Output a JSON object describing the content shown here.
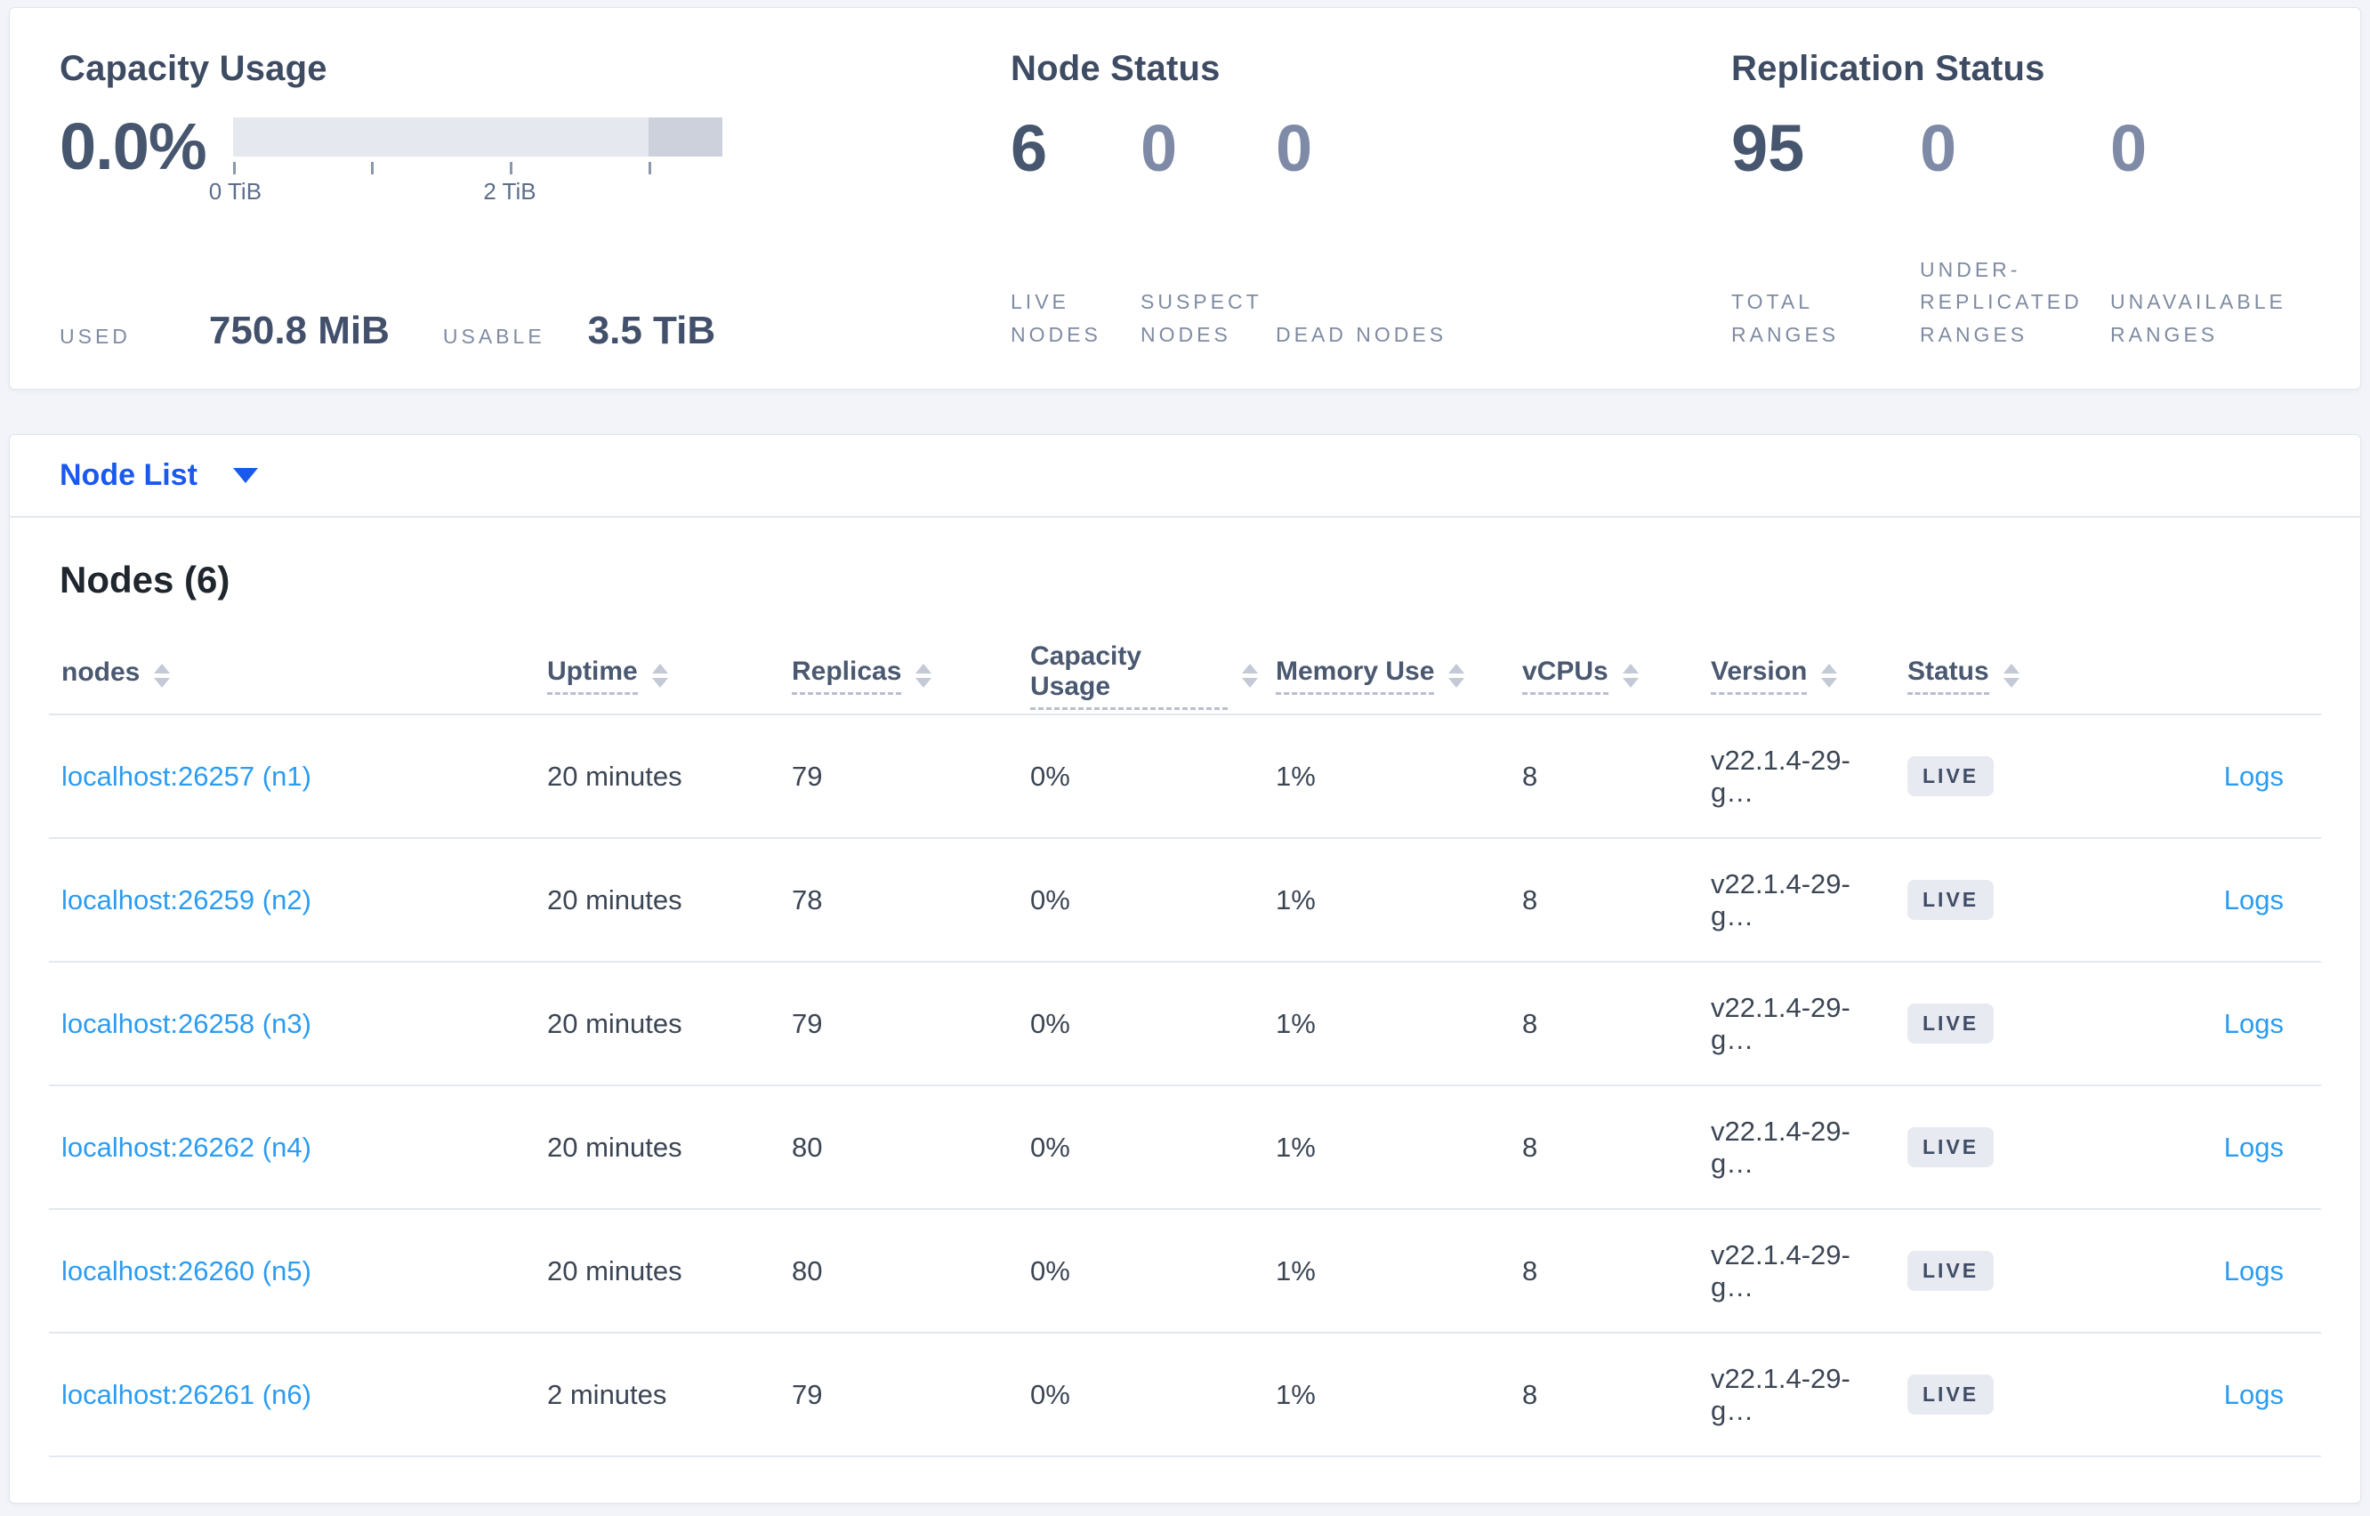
{
  "colors": {
    "page_bg": "#f2f4f9",
    "card_bg": "#ffffff",
    "dropdown_blue": "#1959ee",
    "link_blue": "#2b9cf2",
    "stat_dark": "#47566f",
    "stat_muted": "#7e8aa6",
    "gauge_light": "#e6e8ef",
    "gauge_dark": "#ccd1dc",
    "badge_bg": "#e7eaf0"
  },
  "capacity_panel": {
    "title": "Capacity Usage",
    "percent": "0.0%",
    "axis_tick_labels": [
      "0 TiB",
      "2 TiB"
    ],
    "used_label": "USED",
    "used_value": "750.8 MiB",
    "usable_label": "USABLE",
    "usable_value": "3.5 TiB"
  },
  "node_status_panel": {
    "title": "Node Status",
    "stats": [
      {
        "value": "6",
        "label": "LIVE NODES"
      },
      {
        "value": "0",
        "label": "SUSPECT NODES"
      },
      {
        "value": "0",
        "label": "DEAD NODES"
      }
    ]
  },
  "replication_panel": {
    "title": "Replication Status",
    "stats": [
      {
        "value": "95",
        "label": "TOTAL RANGES"
      },
      {
        "value": "0",
        "label": "UNDER-REPLICATED RANGES"
      },
      {
        "value": "0",
        "label": "UNAVAILABLE RANGES"
      }
    ]
  },
  "node_list_dropdown": {
    "label": "Node List"
  },
  "nodes_table": {
    "title": "Nodes (6)",
    "columns": [
      {
        "label": "nodes"
      },
      {
        "label": "Uptime"
      },
      {
        "label": "Replicas"
      },
      {
        "label": "Capacity Usage"
      },
      {
        "label": "Memory Use"
      },
      {
        "label": "vCPUs"
      },
      {
        "label": "Version"
      },
      {
        "label": "Status"
      },
      {
        "label": ""
      }
    ],
    "rows": [
      {
        "node": "localhost:26257 (n1)",
        "uptime": "20 minutes",
        "replicas": "79",
        "capacity": "0%",
        "memory": "1%",
        "vcpus": "8",
        "version": "v22.1.4-29-g…",
        "status": "LIVE",
        "logs": "Logs"
      },
      {
        "node": "localhost:26259 (n2)",
        "uptime": "20 minutes",
        "replicas": "78",
        "capacity": "0%",
        "memory": "1%",
        "vcpus": "8",
        "version": "v22.1.4-29-g…",
        "status": "LIVE",
        "logs": "Logs"
      },
      {
        "node": "localhost:26258 (n3)",
        "uptime": "20 minutes",
        "replicas": "79",
        "capacity": "0%",
        "memory": "1%",
        "vcpus": "8",
        "version": "v22.1.4-29-g…",
        "status": "LIVE",
        "logs": "Logs"
      },
      {
        "node": "localhost:26262 (n4)",
        "uptime": "20 minutes",
        "replicas": "80",
        "capacity": "0%",
        "memory": "1%",
        "vcpus": "8",
        "version": "v22.1.4-29-g…",
        "status": "LIVE",
        "logs": "Logs"
      },
      {
        "node": "localhost:26260 (n5)",
        "uptime": "20 minutes",
        "replicas": "80",
        "capacity": "0%",
        "memory": "1%",
        "vcpus": "8",
        "version": "v22.1.4-29-g…",
        "status": "LIVE",
        "logs": "Logs"
      },
      {
        "node": "localhost:26261 (n6)",
        "uptime": "2 minutes",
        "replicas": "79",
        "capacity": "0%",
        "memory": "1%",
        "vcpus": "8",
        "version": "v22.1.4-29-g…",
        "status": "LIVE",
        "logs": "Logs"
      }
    ]
  }
}
